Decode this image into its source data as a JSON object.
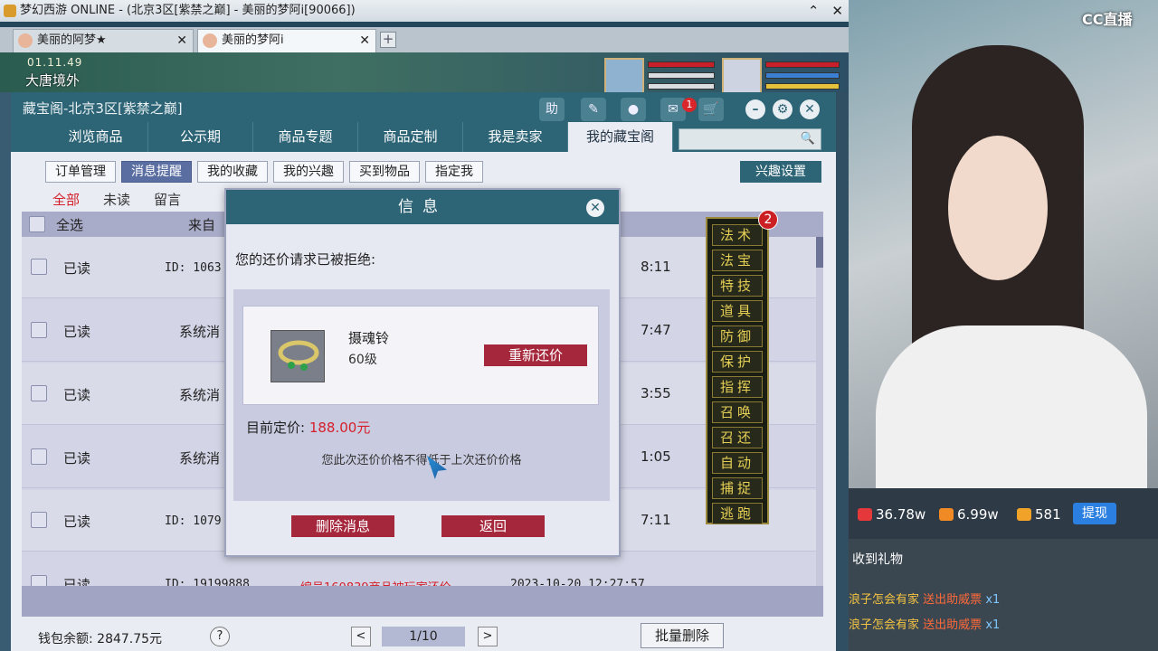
{
  "window": {
    "title": "梦幻西游 ONLINE - (北京3区[紫禁之巅] - 美丽的梦阿i[90066])",
    "tabs": [
      "美丽的阿梦★",
      "美丽的梦阿i"
    ]
  },
  "scene": {
    "time": "01.11.49",
    "place": "大唐境外"
  },
  "cbg": {
    "title": "藏宝阁-北京3区[紫禁之巅]",
    "header_icons": {
      "help": "助",
      "message_badge": "1"
    },
    "main_tabs": [
      "浏览商品",
      "公示期",
      "商品专题",
      "商品定制",
      "我是卖家",
      "我的藏宝阁"
    ],
    "sub_tabs": [
      "订单管理",
      "消息提醒",
      "我的收藏",
      "我的兴趣",
      "买到物品",
      "指定我"
    ],
    "interest_settings": "兴趣设置",
    "filters": [
      "全部",
      "未读",
      "留言"
    ],
    "table_head": {
      "select_all": "全选",
      "from": "来自"
    },
    "rows": [
      {
        "status": "已读",
        "from": "ID: 1063",
        "time": "8:11"
      },
      {
        "status": "已读",
        "from": "系统消",
        "time": "7:47"
      },
      {
        "status": "已读",
        "from": "系统消",
        "time": "3:55"
      },
      {
        "status": "已读",
        "from": "系统消",
        "time": "1:05"
      },
      {
        "status": "已读",
        "from": "ID: 1079",
        "time": "7:11"
      },
      {
        "status": "已读",
        "from": "ID: 19199888",
        "msg": "编号160839商品被玩家还价",
        "time": "2023-10-20 12:27:57"
      }
    ],
    "wallet": "钱包余额: 2847.75元",
    "help_q": "?",
    "pager": {
      "prev": "<",
      "page": "1/10",
      "next": ">"
    },
    "batch_delete": "批量删除"
  },
  "skills": {
    "badge": "2",
    "items": [
      "法术",
      "法宝",
      "特技",
      "道具",
      "防御",
      "保护",
      "指挥",
      "召唤",
      "召还",
      "自动",
      "捕捉",
      "逃跑"
    ]
  },
  "dialog": {
    "title": "信息",
    "close": "✕",
    "message": "您的还价请求已被拒绝:",
    "item_name": "摄魂铃",
    "item_level": "60级",
    "recount_button": "重新还价",
    "price_label": "目前定价:",
    "price_value": "188.00元",
    "hint": "您此次还价价格不得低于上次还价价格",
    "delete_button": "删除消息",
    "back_button": "返回"
  },
  "stream": {
    "logo": "CC直播",
    "stats": {
      "heat": "36.78w",
      "fans": "6.99w",
      "gifts": "581",
      "withdraw": "提现"
    },
    "gifts_title": "收到礼物",
    "gift_lines": [
      {
        "user": "浪子怎会有家",
        "act": "送出助威票",
        "cnt": "x1"
      },
      {
        "user": "浪子怎会有家",
        "act": "送出助威票",
        "cnt": "x1"
      }
    ]
  },
  "colors": {
    "header": "#2d6476",
    "accent_red": "#a5273c",
    "price_red": "#d51f2a"
  }
}
